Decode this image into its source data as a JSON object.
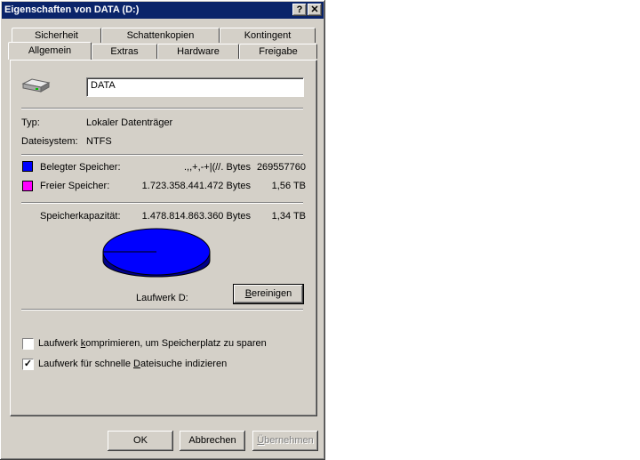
{
  "window": {
    "title": "Eigenschaften von DATA (D:)",
    "help_label": "?",
    "close_label": "✕"
  },
  "tabs_row1": [
    "Sicherheit",
    "Schattenkopien",
    "Kontingent"
  ],
  "tabs_row2": [
    "Allgemein",
    "Extras",
    "Hardware",
    "Freigabe"
  ],
  "general": {
    "drive_name": "DATA",
    "type_label": "Typ:",
    "type_value": "Lokaler Datenträger",
    "fs_label": "Dateisystem:",
    "fs_value": "NTFS",
    "used_label": "Belegter Speicher:",
    "used_bytes": ".,,+,-+|(//. Bytes",
    "used_short": "269557760",
    "free_label": "Freier Speicher:",
    "free_bytes": "1.723.358.441.472 Bytes",
    "free_short": "1,56 TB",
    "capacity_label": "Speicherkapazität:",
    "capacity_bytes": "1.478.814.863.360 Bytes",
    "capacity_short": "1,34 TB",
    "drive_label": "Laufwerk D:",
    "cleanup_prefix": "",
    "cleanup_u": "B",
    "cleanup_rest": "ereinigen",
    "compress_pre": "Laufwerk ",
    "compress_u": "k",
    "compress_rest": "omprimieren, um Speicherplatz zu sparen",
    "compress_checked": false,
    "index_pre": "Laufwerk für schnelle ",
    "index_u": "D",
    "index_rest": "ateisuche indizieren",
    "index_checked": true,
    "check_mark": "✓"
  },
  "colors": {
    "used": "#0000ff",
    "free": "#ff00ff",
    "pie_fill": "#0000ff"
  },
  "buttons": {
    "ok": "OK",
    "cancel": "Abbrechen",
    "apply_u": "Ü",
    "apply_rest": "bernehmen"
  }
}
